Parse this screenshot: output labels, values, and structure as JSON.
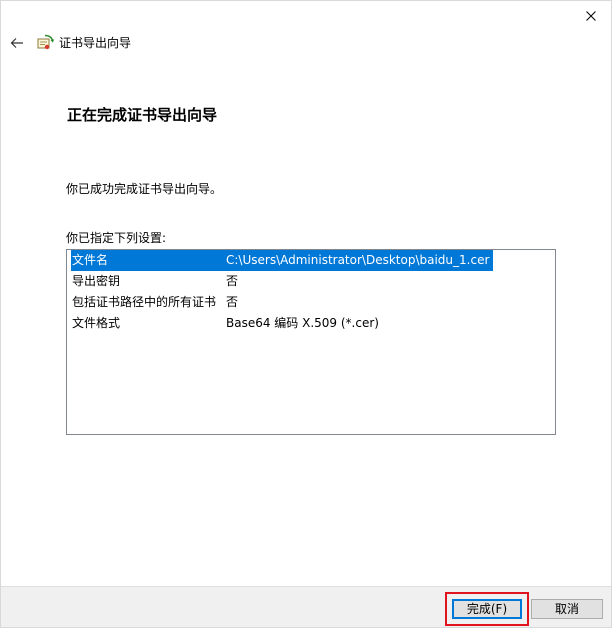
{
  "window": {
    "title": "证书导出向导"
  },
  "icons": {
    "close": "close-icon",
    "back": "arrow-left-icon",
    "wizard": "certificate-wizard-icon"
  },
  "page": {
    "heading": "正在完成证书导出向导",
    "success_message": "你已成功完成证书导出向导。",
    "settings_label": "你已指定下列设置:"
  },
  "settings": {
    "rows": [
      {
        "name": "文件名",
        "value": "C:\\Users\\Administrator\\Desktop\\baidu_1.cer",
        "selected": true
      },
      {
        "name": "导出密钥",
        "value": "否",
        "selected": false
      },
      {
        "name": "包括证书路径中的所有证书",
        "value": "否",
        "selected": false
      },
      {
        "name": "文件格式",
        "value": "Base64 编码 X.509 (*.cer)",
        "selected": false
      }
    ]
  },
  "buttons": {
    "finish_label": "完成(F)",
    "cancel_label": "取消"
  },
  "colors": {
    "selection": "#0078d7",
    "highlight_frame": "#e0141e",
    "footer_bg": "#f0f0f0"
  }
}
